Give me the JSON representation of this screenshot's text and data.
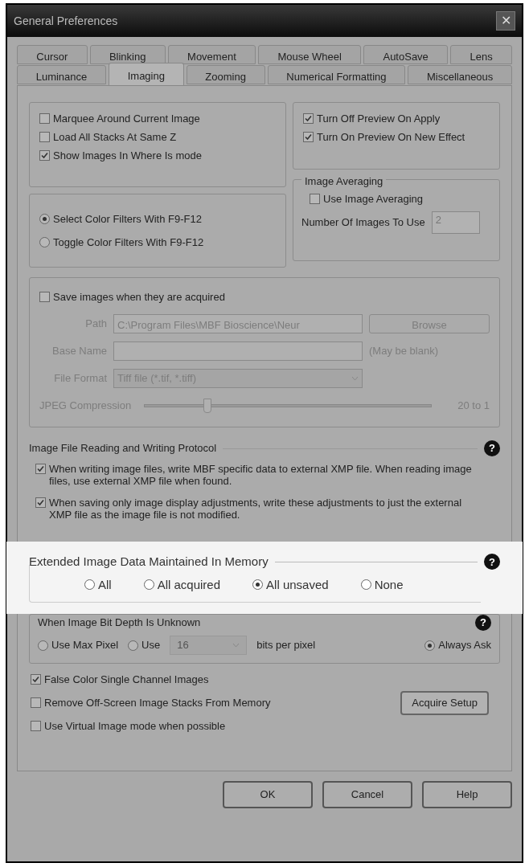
{
  "window": {
    "title": "General Preferences",
    "close": "✕"
  },
  "tabs": [
    [
      {
        "label": "Cursor",
        "selected": false
      },
      {
        "label": "Blinking",
        "selected": false
      },
      {
        "label": "Movement",
        "selected": false
      },
      {
        "label": "Mouse Wheel",
        "selected": false
      },
      {
        "label": "AutoSave",
        "selected": false
      },
      {
        "label": "Lens",
        "selected": false
      }
    ],
    [
      {
        "label": "Luminance",
        "selected": false
      },
      {
        "label": "Imaging",
        "selected": true
      },
      {
        "label": "Zooming",
        "selected": false
      },
      {
        "label": "Numerical Formatting",
        "selected": false
      },
      {
        "label": "Miscellaneous",
        "selected": false
      }
    ]
  ],
  "display_options": [
    {
      "label": "Marquee Around Current Image",
      "checked": false
    },
    {
      "label": "Load All Stacks At Same Z",
      "checked": false
    },
    {
      "label": "Show Images In Where Is mode",
      "checked": true
    }
  ],
  "preview_options": [
    {
      "label": "Turn Off Preview On Apply",
      "checked": true
    },
    {
      "label": "Turn On Preview On New Effect",
      "checked": true
    }
  ],
  "color_filters": [
    {
      "label": "Select Color Filters With F9-F12",
      "selected": true
    },
    {
      "label": "Toggle Color Filters With F9-F12",
      "selected": false
    }
  ],
  "image_averaging": {
    "title": "Image Averaging",
    "checkbox": {
      "label": "Use Image Averaging",
      "checked": false
    },
    "count_label": "Number Of Images To Use",
    "count": "2"
  },
  "save_images": {
    "checkbox": {
      "label": "Save images when they are acquired",
      "checked": false
    },
    "path_label": "Path",
    "path": "C:\\Program Files\\MBF Bioscience\\Neur",
    "browse": "Browse",
    "base_label": "Base Name",
    "base_hint": "(May be blank)",
    "format_label": "File Format",
    "format": "Tiff file (*.tif, *.tiff)",
    "jpeg_label": "JPEG Compression",
    "jpeg_slider": {
      "level": 0.22
    },
    "jpeg_reading": "20 to 1"
  },
  "protocol": {
    "title": "Image File Reading and Writing Protocol",
    "help": "?",
    "options": [
      {
        "label": "When writing image files, write MBF specific data to external XMP file. When reading image files, use external XMP file when found.",
        "checked": true
      },
      {
        "label": "When saving only image display adjustments, write these adjustments to just the external XMP file as the image file is not modified.",
        "checked": true
      }
    ]
  },
  "extended_data": {
    "title": "Extended Image Data Maintained In Memory",
    "help": "?",
    "options": [
      {
        "label": "All",
        "selected": false
      },
      {
        "label": "All acquired",
        "selected": false
      },
      {
        "label": "All unsaved",
        "selected": true
      },
      {
        "label": "None",
        "selected": false
      }
    ]
  },
  "bit_depth": {
    "title": "When Image Bit Depth Is Unknown",
    "help": "?",
    "max_pixel": {
      "label": "Use Max Pixel",
      "selected": false
    },
    "use": {
      "label": "Use",
      "selected": false
    },
    "bits": "16",
    "bits_label": "bits per pixel",
    "ask": {
      "label": "Always Ask",
      "selected": true
    }
  },
  "options": [
    {
      "label": "False Color Single Channel Images",
      "checked": true
    },
    {
      "label": "Remove Off-Screen Image Stacks From Memory",
      "checked": false
    },
    {
      "label": "Use Virtual Image mode when possible",
      "checked": false
    }
  ],
  "acquire_setup": "Acquire Setup",
  "buttons": [
    "OK",
    "Cancel",
    "Help"
  ]
}
